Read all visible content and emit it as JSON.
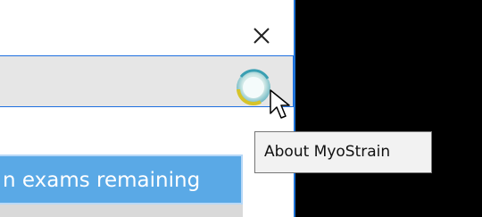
{
  "window": {
    "close_icon": "close-icon",
    "logo_icon": "myostrain-logo-icon",
    "banner_text": "n exams remaining",
    "colors": {
      "accent": "#1f6fe0",
      "banner_bg": "#5aa9e6",
      "toolbar_bg": "#e6e6e6"
    }
  },
  "tooltip": {
    "text": "About MyoStrain"
  },
  "pointer": {
    "icon": "mouse-pointer-icon"
  }
}
